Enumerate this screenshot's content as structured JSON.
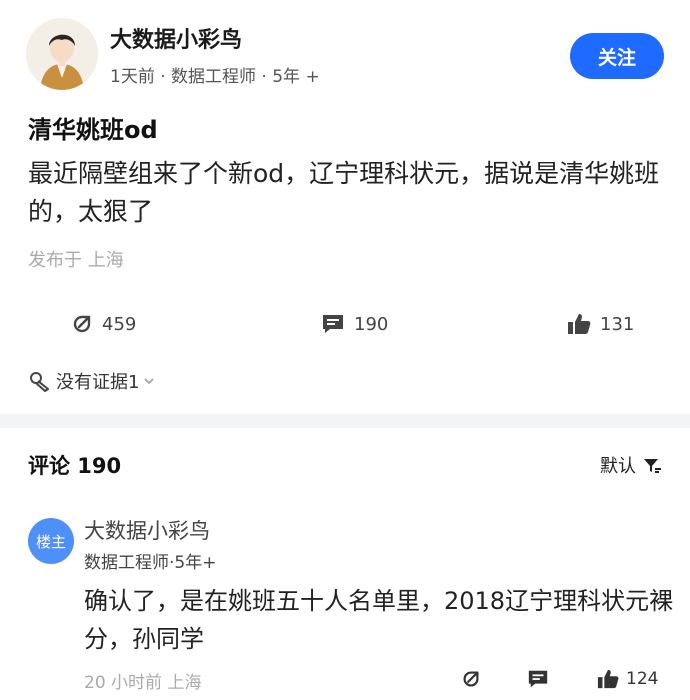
{
  "post": {
    "author": {
      "name": "大数据小彩鸟",
      "meta": "1天前 · 数据工程师 · 5年 +"
    },
    "follow_label": "关注",
    "title": "清华姚班od",
    "body": "最近隔壁组来了个新od，辽宁理科状元，据说是清华姚班的，太狠了",
    "location": "发布于 上海",
    "stats": {
      "share": "459",
      "comments": "190",
      "likes": "131"
    },
    "evidence_label": "没有证据1"
  },
  "comments": {
    "heading": "评论 190",
    "sort_label": "默认",
    "items": [
      {
        "avatar_label": "楼主",
        "name": "大数据小彩鸟",
        "meta": "数据工程师·5年+",
        "body": "确认了，是在姚班五十人名单里，2018辽宁理科状元裸分，孙同学",
        "time_location": "20 小时前  上海",
        "likes": "124"
      }
    ]
  },
  "colors": {
    "accent": "#1f6bff",
    "op_badge": "#4f8ff8"
  }
}
